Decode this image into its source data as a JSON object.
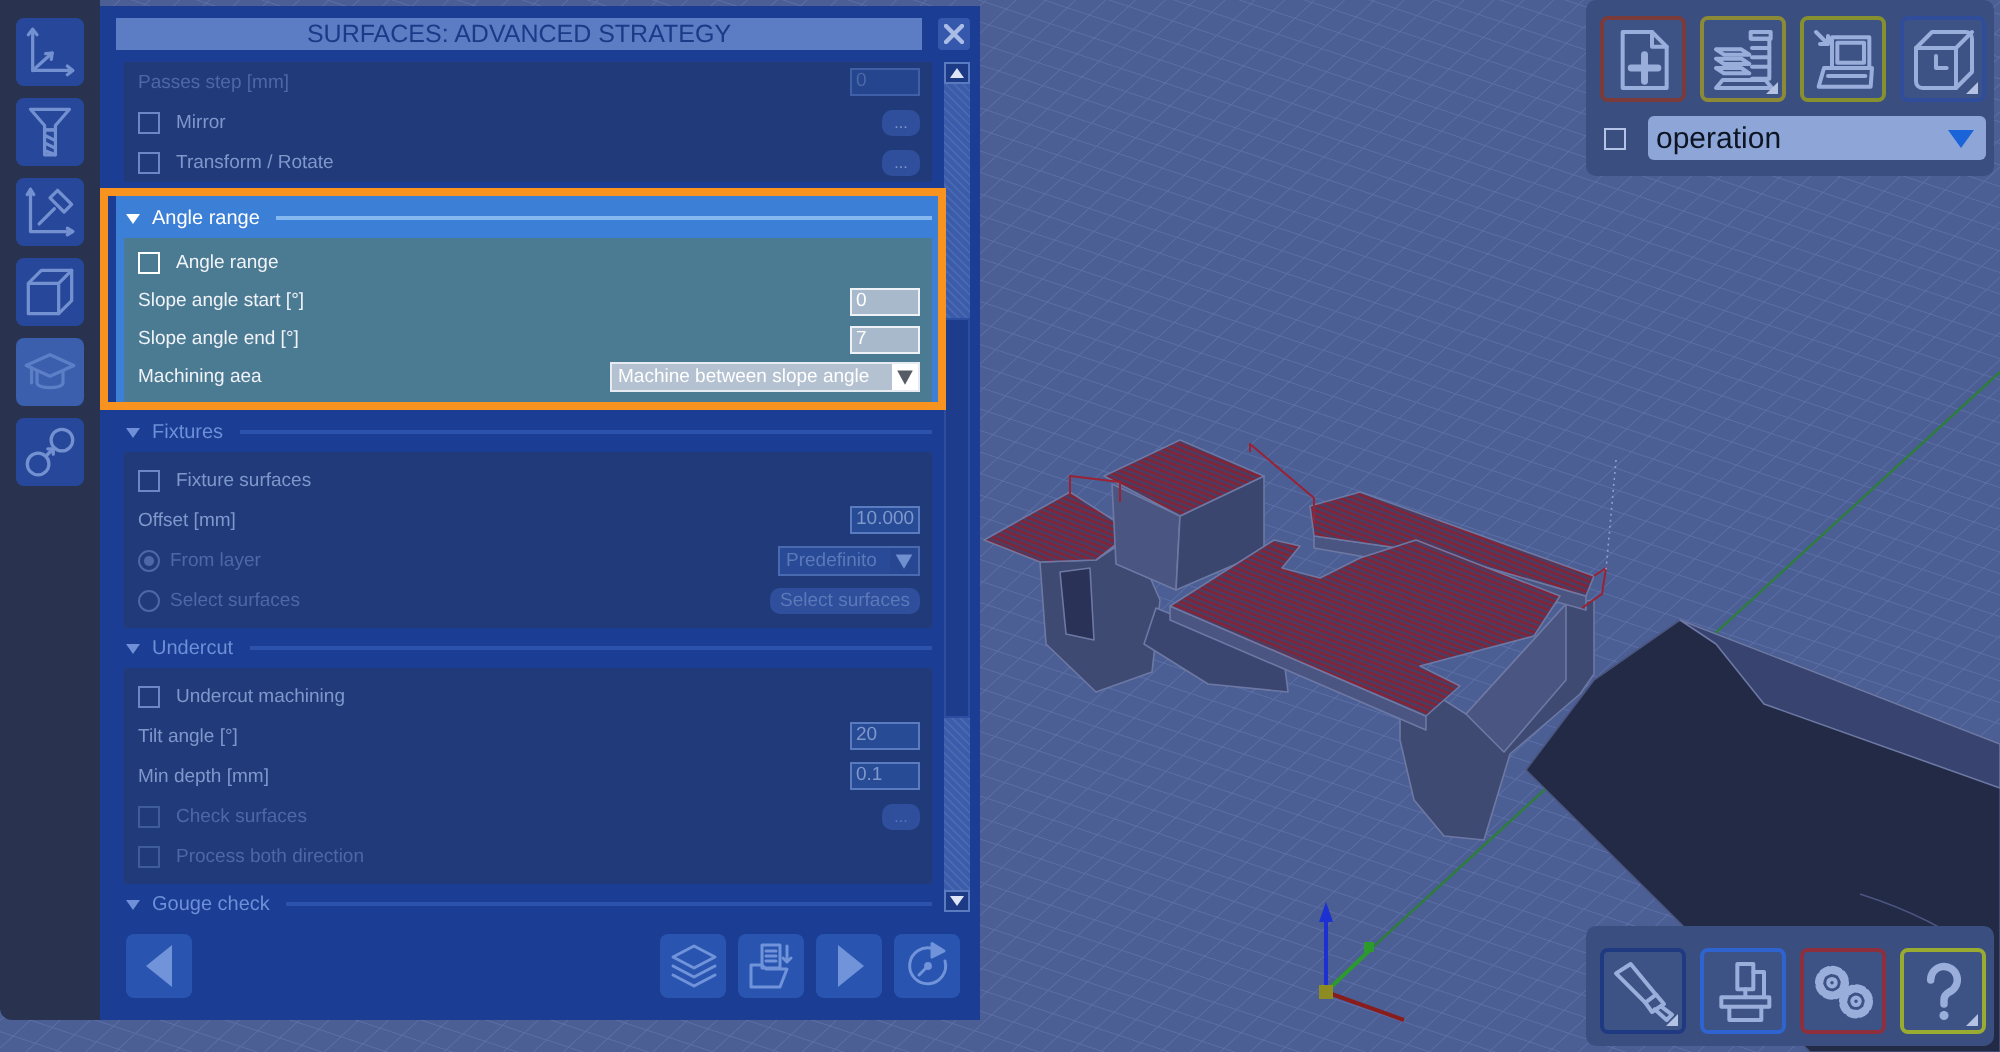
{
  "sidebar": {
    "items": [
      {
        "selected": false
      },
      {
        "selected": false
      },
      {
        "selected": false
      },
      {
        "selected": false
      },
      {
        "selected": true
      },
      {
        "selected": false
      }
    ]
  },
  "panel": {
    "title": "SURFACES: ADVANCED STRATEGY",
    "sections": [
      {
        "rows": [
          {
            "kind": "field",
            "label": "Passes step [mm]",
            "value": "0",
            "disabled": true
          },
          {
            "kind": "checkbox",
            "label": "Mirror",
            "checked": false,
            "disabled": false,
            "button": "..."
          },
          {
            "kind": "checkbox",
            "label": "Transform / Rotate",
            "checked": false,
            "disabled": false,
            "button": "..."
          }
        ]
      },
      {
        "title": "Angle range",
        "expanded": true,
        "highlighted": true,
        "rows": [
          {
            "kind": "checkbox",
            "label": "Angle range",
            "checked": false,
            "disabled": false
          },
          {
            "kind": "field",
            "label": "Slope angle start [°]",
            "value": "0",
            "disabled": false
          },
          {
            "kind": "field",
            "label": "Slope angle end [°]",
            "value": "7",
            "disabled": false
          },
          {
            "kind": "dropdown",
            "label": "Machining aea",
            "value": "Machine between slope angle",
            "disabled": false
          }
        ]
      },
      {
        "title": "Fixtures",
        "expanded": true,
        "highlighted": false,
        "rows": [
          {
            "kind": "checkbox",
            "label": "Fixture surfaces",
            "checked": false,
            "disabled": false
          },
          {
            "kind": "field",
            "label": "Offset [mm]",
            "value": "10.000",
            "disabled": false
          },
          {
            "kind": "radio",
            "label": "From layer",
            "selected": true,
            "disabled": true,
            "dropdown": "Predefinito"
          },
          {
            "kind": "radio",
            "label": "Select surfaces",
            "selected": false,
            "disabled": true,
            "button": "Select surfaces"
          }
        ]
      },
      {
        "title": "Undercut",
        "expanded": true,
        "highlighted": false,
        "rows": [
          {
            "kind": "checkbox",
            "label": "Undercut machining",
            "checked": false,
            "disabled": false
          },
          {
            "kind": "field",
            "label": "Tilt angle [°]",
            "value": "20",
            "disabled": false
          },
          {
            "kind": "field",
            "label": "Min depth [mm]",
            "value": "0.1",
            "disabled": false
          },
          {
            "kind": "checkbox",
            "label": "Check surfaces",
            "checked": false,
            "disabled": true,
            "button": "..."
          },
          {
            "kind": "checkbox",
            "label": "Process both direction",
            "checked": false,
            "disabled": true
          }
        ]
      },
      {
        "title": "Gouge check",
        "expanded": true,
        "highlighted": false
      }
    ]
  },
  "toolbar_top": {
    "buttons": [
      {
        "color": "#7b3b3a",
        "menu": false
      },
      {
        "color": "#8c8a37",
        "menu": true
      },
      {
        "color": "#86902f",
        "menu": false
      },
      {
        "color": "#2f4d9b",
        "menu": true
      }
    ],
    "checkbox": {
      "checked": false
    },
    "dropdown": {
      "value": "operation"
    }
  },
  "toolbar_bottom": {
    "buttons": [
      {
        "color": "#1f3a80",
        "menu": true
      },
      {
        "color": "#2e63d0",
        "menu": false
      },
      {
        "color": "#8d2f3d",
        "menu": false
      },
      {
        "color": "#9aab31",
        "menu": true
      }
    ]
  }
}
